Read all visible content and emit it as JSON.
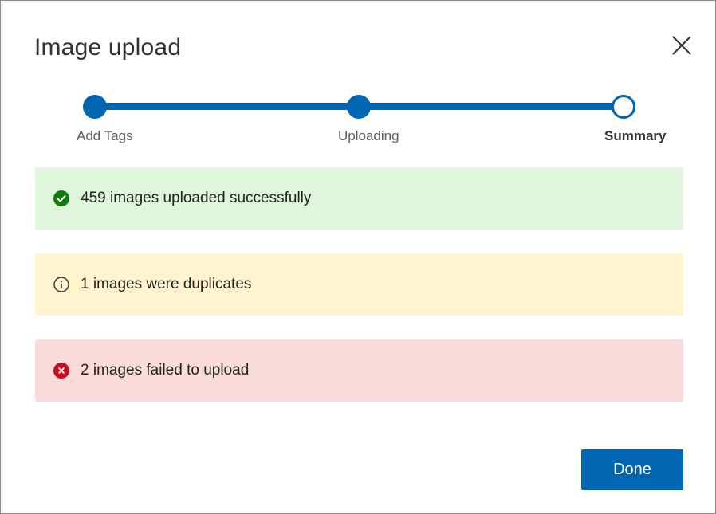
{
  "dialog": {
    "title": "Image upload",
    "close_icon": "close-icon"
  },
  "stepper": {
    "steps": [
      {
        "label": "Add Tags",
        "state": "complete"
      },
      {
        "label": "Uploading",
        "state": "complete"
      },
      {
        "label": "Summary",
        "state": "current"
      }
    ],
    "color": "#0065b3"
  },
  "results": {
    "success": {
      "text": "459 images uploaded successfully",
      "icon": "check-circle-icon",
      "bg": "#dff6dd",
      "icon_color": "#107c10"
    },
    "warning": {
      "text": "1 images were duplicates",
      "icon": "info-circle-icon",
      "bg": "#fff4ce",
      "icon_color": "#323130"
    },
    "error": {
      "text": "2 images failed to upload",
      "icon": "error-circle-icon",
      "bg": "#fadbdc",
      "icon_color": "#c50f1f"
    }
  },
  "footer": {
    "done_label": "Done"
  }
}
